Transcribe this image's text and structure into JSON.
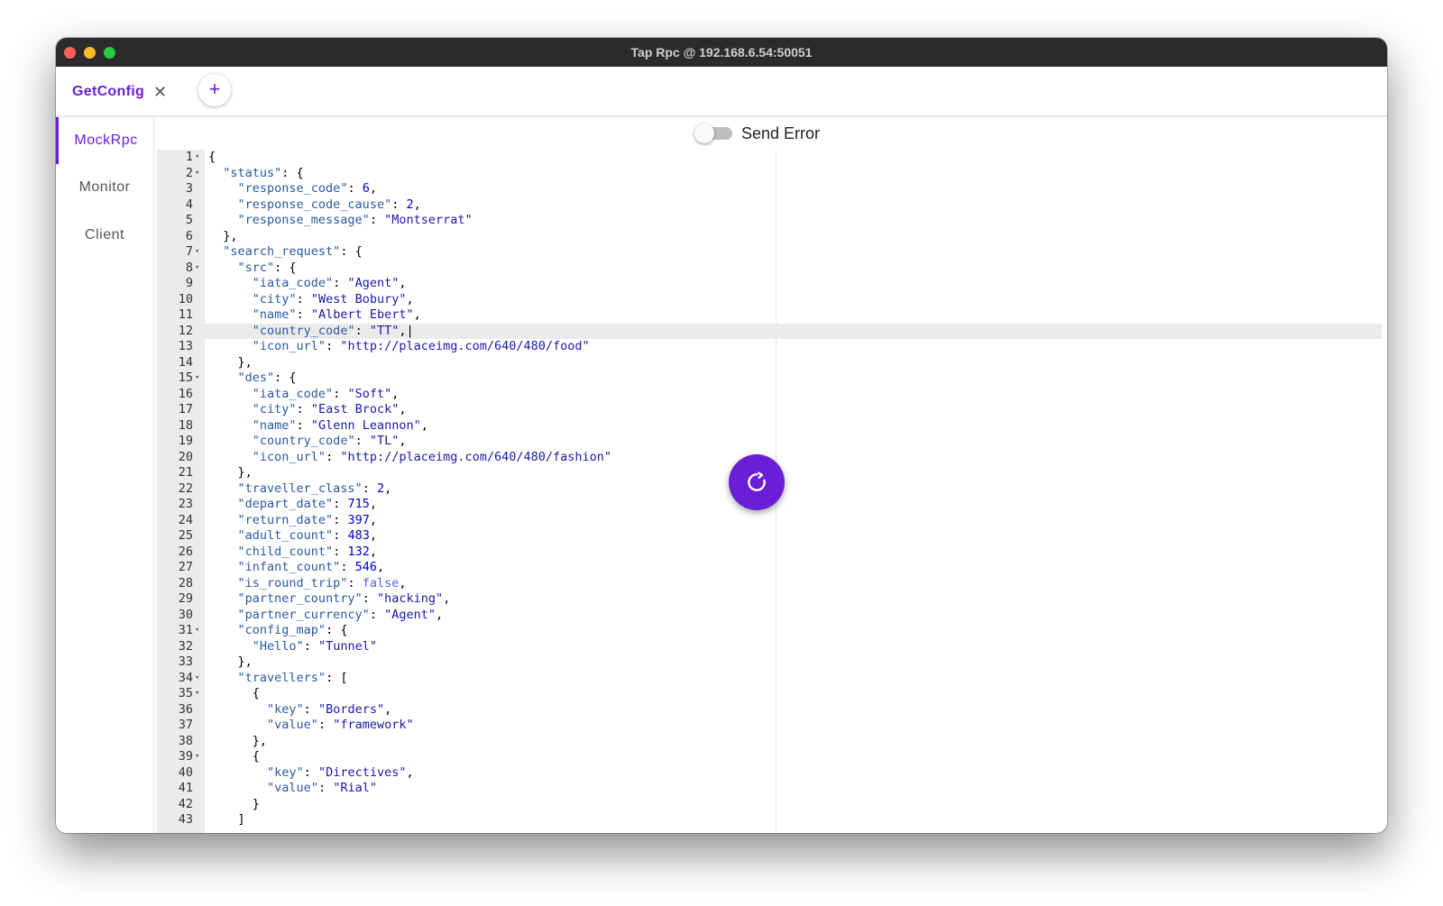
{
  "window": {
    "title": "Tap Rpc @ 192.168.6.54:50051"
  },
  "tabs": [
    {
      "label": "GetConfig",
      "close_icon": "close-icon"
    }
  ],
  "add_tab": {
    "label": "+"
  },
  "sidebar": {
    "items": [
      {
        "label": "MockRpc",
        "active": true
      },
      {
        "label": "Monitor",
        "active": false
      },
      {
        "label": "Client",
        "active": false
      }
    ]
  },
  "toolbar": {
    "send_error_label": "Send Error",
    "send_error_on": false
  },
  "editor": {
    "active_line": 12,
    "fold_lines": [
      1,
      2,
      7,
      8,
      15,
      31,
      34,
      35,
      39
    ],
    "lines": [
      [
        [
          "",
          "{"
        ]
      ],
      [
        [
          "",
          "  "
        ],
        [
          "k",
          "\"status\""
        ],
        [
          "",
          ": {"
        ]
      ],
      [
        [
          "",
          "    "
        ],
        [
          "k",
          "\"response_code\""
        ],
        [
          "",
          ": "
        ],
        [
          "n",
          "6"
        ],
        [
          "",
          ","
        ]
      ],
      [
        [
          "",
          "    "
        ],
        [
          "k",
          "\"response_code_cause\""
        ],
        [
          "",
          ": "
        ],
        [
          "n",
          "2"
        ],
        [
          "",
          ","
        ]
      ],
      [
        [
          "",
          "    "
        ],
        [
          "k",
          "\"response_message\""
        ],
        [
          "",
          ": "
        ],
        [
          "s",
          "\"Montserrat\""
        ]
      ],
      [
        [
          "",
          "  },"
        ]
      ],
      [
        [
          "",
          "  "
        ],
        [
          "k",
          "\"search_request\""
        ],
        [
          "",
          ": {"
        ]
      ],
      [
        [
          "",
          "    "
        ],
        [
          "k",
          "\"src\""
        ],
        [
          "",
          ": {"
        ]
      ],
      [
        [
          "",
          "      "
        ],
        [
          "k",
          "\"iata_code\""
        ],
        [
          "",
          ": "
        ],
        [
          "s",
          "\"Agent\""
        ],
        [
          "",
          ","
        ]
      ],
      [
        [
          "",
          "      "
        ],
        [
          "k",
          "\"city\""
        ],
        [
          "",
          ": "
        ],
        [
          "s",
          "\"West Bobury\""
        ],
        [
          "",
          ","
        ]
      ],
      [
        [
          "",
          "      "
        ],
        [
          "k",
          "\"name\""
        ],
        [
          "",
          ": "
        ],
        [
          "s",
          "\"Albert Ebert\""
        ],
        [
          "",
          ","
        ]
      ],
      [
        [
          "",
          "      "
        ],
        [
          "k",
          "\"country_code\""
        ],
        [
          "",
          ": "
        ],
        [
          "s",
          "\"TT\""
        ],
        [
          "",
          ",|"
        ]
      ],
      [
        [
          "",
          "      "
        ],
        [
          "k",
          "\"icon_url\""
        ],
        [
          "",
          ": "
        ],
        [
          "s",
          "\"http://placeimg.com/640/480/food\""
        ]
      ],
      [
        [
          "",
          "    },"
        ]
      ],
      [
        [
          "",
          "    "
        ],
        [
          "k",
          "\"des\""
        ],
        [
          "",
          ": {"
        ]
      ],
      [
        [
          "",
          "      "
        ],
        [
          "k",
          "\"iata_code\""
        ],
        [
          "",
          ": "
        ],
        [
          "s",
          "\"Soft\""
        ],
        [
          "",
          ","
        ]
      ],
      [
        [
          "",
          "      "
        ],
        [
          "k",
          "\"city\""
        ],
        [
          "",
          ": "
        ],
        [
          "s",
          "\"East Brock\""
        ],
        [
          "",
          ","
        ]
      ],
      [
        [
          "",
          "      "
        ],
        [
          "k",
          "\"name\""
        ],
        [
          "",
          ": "
        ],
        [
          "s",
          "\"Glenn Leannon\""
        ],
        [
          "",
          ","
        ]
      ],
      [
        [
          "",
          "      "
        ],
        [
          "k",
          "\"country_code\""
        ],
        [
          "",
          ": "
        ],
        [
          "s",
          "\"TL\""
        ],
        [
          "",
          ","
        ]
      ],
      [
        [
          "",
          "      "
        ],
        [
          "k",
          "\"icon_url\""
        ],
        [
          "",
          ": "
        ],
        [
          "s",
          "\"http://placeimg.com/640/480/fashion\""
        ]
      ],
      [
        [
          "",
          "    },"
        ]
      ],
      [
        [
          "",
          "    "
        ],
        [
          "k",
          "\"traveller_class\""
        ],
        [
          "",
          ": "
        ],
        [
          "n",
          "2"
        ],
        [
          "",
          ","
        ]
      ],
      [
        [
          "",
          "    "
        ],
        [
          "k",
          "\"depart_date\""
        ],
        [
          "",
          ": "
        ],
        [
          "n",
          "715"
        ],
        [
          "",
          ","
        ]
      ],
      [
        [
          "",
          "    "
        ],
        [
          "k",
          "\"return_date\""
        ],
        [
          "",
          ": "
        ],
        [
          "n",
          "397"
        ],
        [
          "",
          ","
        ]
      ],
      [
        [
          "",
          "    "
        ],
        [
          "k",
          "\"adult_count\""
        ],
        [
          "",
          ": "
        ],
        [
          "n",
          "483"
        ],
        [
          "",
          ","
        ]
      ],
      [
        [
          "",
          "    "
        ],
        [
          "k",
          "\"child_count\""
        ],
        [
          "",
          ": "
        ],
        [
          "n",
          "132"
        ],
        [
          "",
          ","
        ]
      ],
      [
        [
          "",
          "    "
        ],
        [
          "k",
          "\"infant_count\""
        ],
        [
          "",
          ": "
        ],
        [
          "n",
          "546"
        ],
        [
          "",
          ","
        ]
      ],
      [
        [
          "",
          "    "
        ],
        [
          "k",
          "\"is_round_trip\""
        ],
        [
          "",
          ": "
        ],
        [
          "b",
          "false"
        ],
        [
          "",
          ","
        ]
      ],
      [
        [
          "",
          "    "
        ],
        [
          "k",
          "\"partner_country\""
        ],
        [
          "",
          ": "
        ],
        [
          "s",
          "\"hacking\""
        ],
        [
          "",
          ","
        ]
      ],
      [
        [
          "",
          "    "
        ],
        [
          "k",
          "\"partner_currency\""
        ],
        [
          "",
          ": "
        ],
        [
          "s",
          "\"Agent\""
        ],
        [
          "",
          ","
        ]
      ],
      [
        [
          "",
          "    "
        ],
        [
          "k",
          "\"config_map\""
        ],
        [
          "",
          ": {"
        ]
      ],
      [
        [
          "",
          "      "
        ],
        [
          "k",
          "\"Hello\""
        ],
        [
          "",
          ": "
        ],
        [
          "s",
          "\"Tunnel\""
        ]
      ],
      [
        [
          "",
          "    },"
        ]
      ],
      [
        [
          "",
          "    "
        ],
        [
          "k",
          "\"travellers\""
        ],
        [
          "",
          ": ["
        ]
      ],
      [
        [
          "",
          "      {"
        ]
      ],
      [
        [
          "",
          "        "
        ],
        [
          "k",
          "\"key\""
        ],
        [
          "",
          ": "
        ],
        [
          "s",
          "\"Borders\""
        ],
        [
          "",
          ","
        ]
      ],
      [
        [
          "",
          "        "
        ],
        [
          "k",
          "\"value\""
        ],
        [
          "",
          ": "
        ],
        [
          "s",
          "\"framework\""
        ]
      ],
      [
        [
          "",
          "      },"
        ]
      ],
      [
        [
          "",
          "      {"
        ]
      ],
      [
        [
          "",
          "        "
        ],
        [
          "k",
          "\"key\""
        ],
        [
          "",
          ": "
        ],
        [
          "s",
          "\"Directives\""
        ],
        [
          "",
          ","
        ]
      ],
      [
        [
          "",
          "        "
        ],
        [
          "k",
          "\"value\""
        ],
        [
          "",
          ": "
        ],
        [
          "s",
          "\"Rial\""
        ]
      ],
      [
        [
          "",
          "      }"
        ]
      ],
      [
        [
          "",
          "    ]"
        ]
      ]
    ]
  },
  "fab": {
    "icon": "refresh-icon"
  }
}
